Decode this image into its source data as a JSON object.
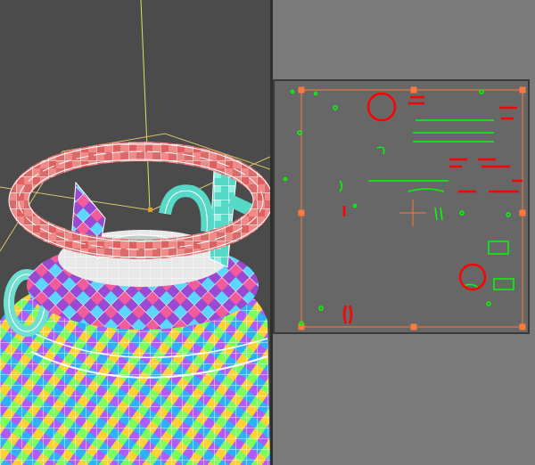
{
  "app": {
    "window": "unwrap-uvw-editor"
  },
  "viewport": {
    "object": "lantern-mesh",
    "display": "checker-uv-wireframe",
    "colors": {
      "background": "#4b4b4b",
      "wire": "#ffffff",
      "gizmo": "#e0e060",
      "bounds": "#d9c36a"
    }
  },
  "uv_editor": {
    "colors": {
      "background": "#676767",
      "islands": "#00ff00",
      "selected": "#ff0000",
      "bounds": "#ff7a3a",
      "frame": "#3a3a3a"
    },
    "icons": [
      "pivot-cross-icon",
      "selection-circle-icon"
    ]
  }
}
